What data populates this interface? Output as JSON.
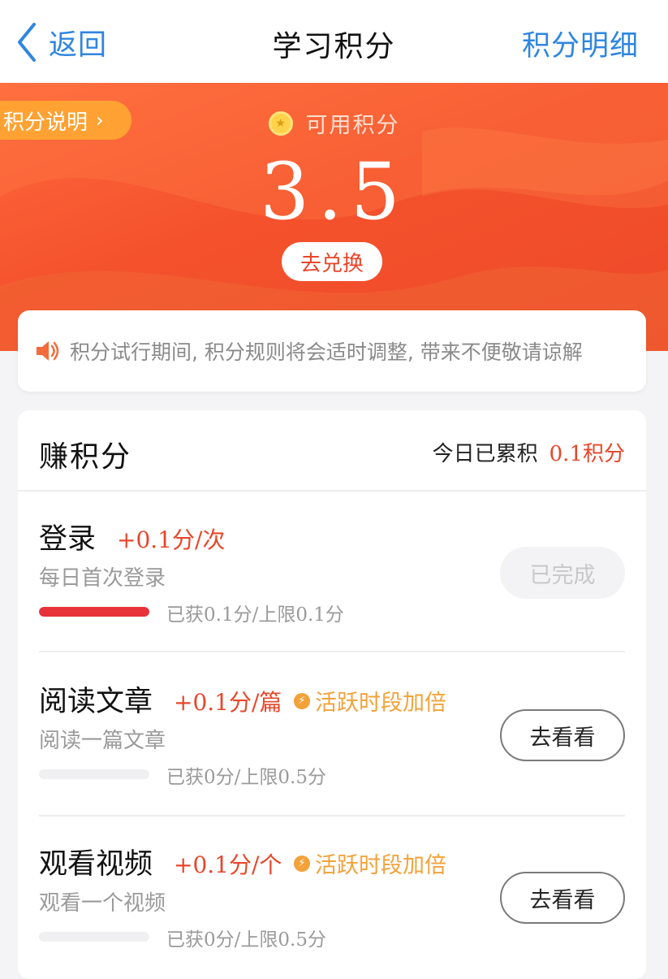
{
  "nav": {
    "back_label": "返回",
    "title": "学习积分",
    "detail_label": "积分明细",
    "accent_color": "#2f86e0"
  },
  "banner": {
    "rules_label": "积分说明",
    "available_label": "可用积分",
    "score": "3.5",
    "redeem_label": "去兑换",
    "bg_color": "#f4512c"
  },
  "notice": {
    "icon": "speaker-icon",
    "text": "积分试行期间, 积分规则将会适时调整, 带来不便敬请谅解"
  },
  "earn": {
    "title": "赚积分",
    "today_label": "今日已累积",
    "today_value": "0.1积分",
    "tasks": [
      {
        "name": "登录",
        "points": "+0.1分/次",
        "bonus": "",
        "desc": "每日首次登录",
        "progress_text": "已获0.1分/上限0.1分",
        "progress_ratio": 1.0,
        "button": "已完成",
        "status": "done"
      },
      {
        "name": "阅读文章",
        "points": "+0.1分/篇",
        "bonus": "活跃时段加倍",
        "desc": "阅读一篇文章",
        "progress_text": "已获0分/上限0.5分",
        "progress_ratio": 0.0,
        "button": "去看看",
        "status": "todo"
      },
      {
        "name": "观看视频",
        "points": "+0.1分/个",
        "bonus": "活跃时段加倍",
        "desc": "观看一个视频",
        "progress_text": "已获0分/上限0.5分",
        "progress_ratio": 0.0,
        "button": "去看看",
        "status": "todo"
      }
    ]
  }
}
